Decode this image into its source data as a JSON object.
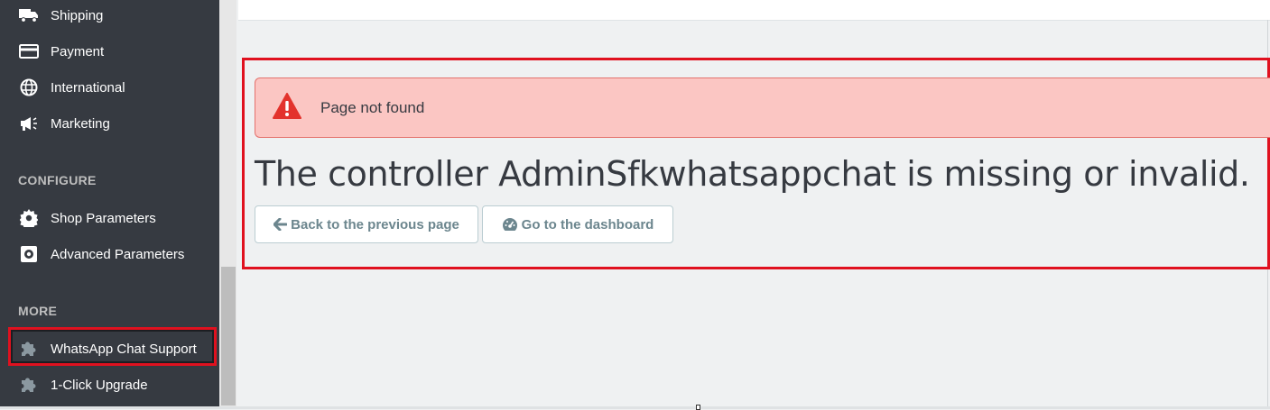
{
  "sidebar": {
    "items_top": [
      {
        "label": "Shipping",
        "icon": "truck-icon"
      },
      {
        "label": "Payment",
        "icon": "credit-card-icon"
      },
      {
        "label": "International",
        "icon": "globe-icon"
      },
      {
        "label": "Marketing",
        "icon": "megaphone-icon"
      }
    ],
    "configure_title": "CONFIGURE",
    "configure_items": [
      {
        "label": "Shop Parameters",
        "icon": "gear-icon"
      },
      {
        "label": "Advanced Parameters",
        "icon": "settings-box-icon"
      }
    ],
    "more_title": "MORE",
    "more_items": [
      {
        "label": "WhatsApp Chat Support",
        "icon": "puzzle-icon"
      },
      {
        "label": "1-Click Upgrade",
        "icon": "puzzle-icon"
      }
    ]
  },
  "alert": {
    "message": "Page not found",
    "icon": "warning-icon"
  },
  "error": {
    "headline": "The controller AdminSfkwhatsappchat is missing or invalid."
  },
  "buttons": {
    "back_label": "Back to the previous page",
    "dashboard_label": "Go to the dashboard"
  },
  "colors": {
    "sidebar_bg": "#363a41",
    "highlight": "#e0111f",
    "alert_bg": "#fbc6c3",
    "alert_icon": "#e3322c"
  }
}
